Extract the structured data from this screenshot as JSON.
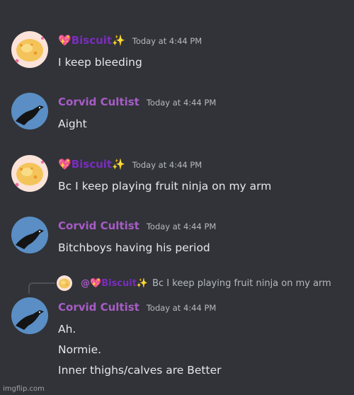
{
  "messages": [
    {
      "author": "Biscuit",
      "author_prefix_emoji": "💖",
      "author_suffix_emoji": "✨",
      "timestamp": "Today at 4:44 PM",
      "lines": [
        "I keep bleeding"
      ]
    },
    {
      "author": "Corvid Cultist",
      "timestamp": "Today at 4:44 PM",
      "lines": [
        "Aight"
      ]
    },
    {
      "author": "Biscuit",
      "author_prefix_emoji": "💖",
      "author_suffix_emoji": "✨",
      "timestamp": "Today at 4:44 PM",
      "lines": [
        "Bc I keep playing fruit ninja on my arm"
      ]
    },
    {
      "author": "Corvid Cultist",
      "timestamp": "Today at 4:44 PM",
      "lines": [
        "Bitchboys having his period"
      ]
    },
    {
      "reply": {
        "at": "@",
        "author": "Biscuit",
        "author_prefix_emoji": "💖",
        "author_suffix_emoji": "✨",
        "text": "Bc I keep playing fruit ninja on my arm"
      },
      "author": "Corvid Cultist",
      "timestamp": "Today at 4:44 PM",
      "lines": [
        "Ah.",
        "Normie.",
        "Inner thighs/calves are Better"
      ]
    }
  ],
  "watermark": "imgflip.com",
  "colors": {
    "background": "#313338",
    "corvid_name": "#a85cc7",
    "biscuit_name": "#7b2cbf",
    "message_text": "#e6e7ea",
    "timestamp": "#b5bac1"
  },
  "icons": {
    "biscuit_avatar": "biscuit-avatar-icon",
    "corvid_avatar": "crow-avatar-icon"
  }
}
